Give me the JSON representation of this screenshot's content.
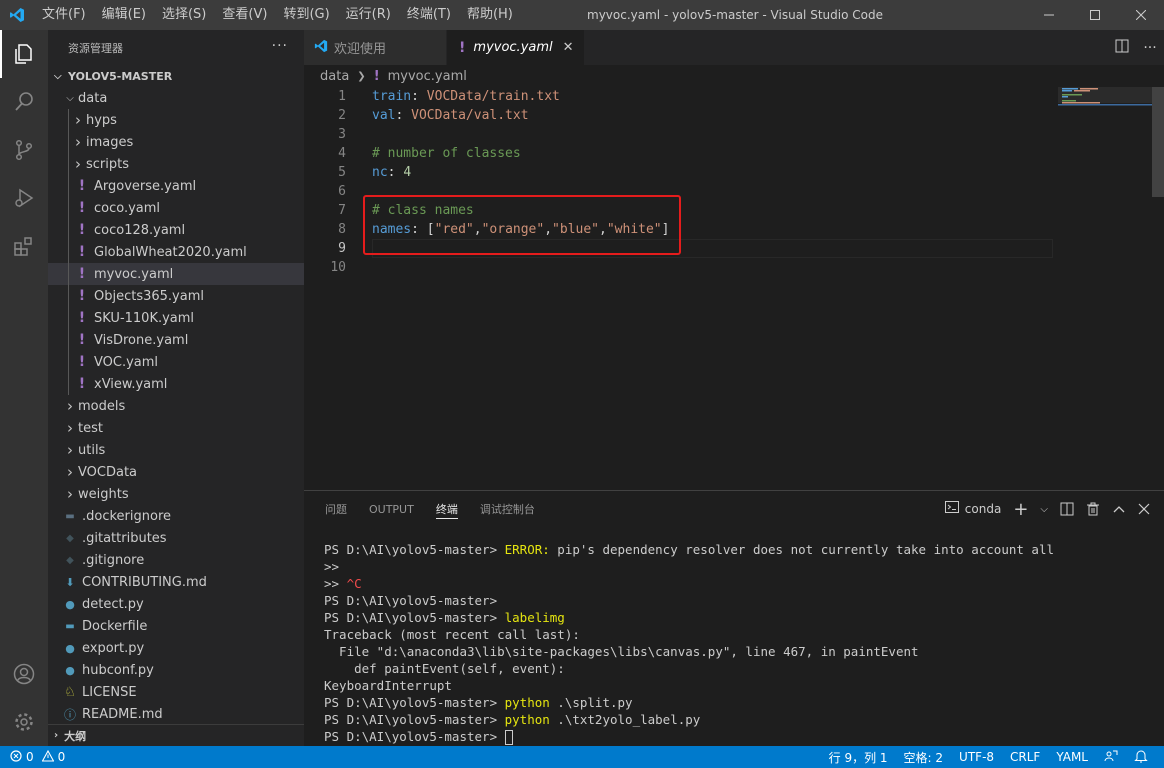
{
  "titlebar": {
    "menu": [
      "文件(F)",
      "编辑(E)",
      "选择(S)",
      "查看(V)",
      "转到(G)",
      "运行(R)",
      "终端(T)",
      "帮助(H)"
    ],
    "title": "myvoc.yaml - yolov5-master - Visual Studio Code"
  },
  "sidebar": {
    "header": "资源管理器",
    "more": "···",
    "root": "YOLOV5-MASTER",
    "tree": [
      {
        "label": "data",
        "depth": 1,
        "kind": "folder-open"
      },
      {
        "label": "hyps",
        "depth": 2,
        "kind": "folder"
      },
      {
        "label": "images",
        "depth": 2,
        "kind": "folder"
      },
      {
        "label": "scripts",
        "depth": 2,
        "kind": "folder"
      },
      {
        "label": "Argoverse.yaml",
        "depth": 2,
        "kind": "yaml"
      },
      {
        "label": "coco.yaml",
        "depth": 2,
        "kind": "yaml"
      },
      {
        "label": "coco128.yaml",
        "depth": 2,
        "kind": "yaml"
      },
      {
        "label": "GlobalWheat2020.yaml",
        "depth": 2,
        "kind": "yaml"
      },
      {
        "label": "myvoc.yaml",
        "depth": 2,
        "kind": "yaml",
        "selected": true
      },
      {
        "label": "Objects365.yaml",
        "depth": 2,
        "kind": "yaml"
      },
      {
        "label": "SKU-110K.yaml",
        "depth": 2,
        "kind": "yaml"
      },
      {
        "label": "VisDrone.yaml",
        "depth": 2,
        "kind": "yaml"
      },
      {
        "label": "VOC.yaml",
        "depth": 2,
        "kind": "yaml"
      },
      {
        "label": "xView.yaml",
        "depth": 2,
        "kind": "yaml"
      },
      {
        "label": "models",
        "depth": 1,
        "kind": "folder"
      },
      {
        "label": "test",
        "depth": 1,
        "kind": "folder"
      },
      {
        "label": "utils",
        "depth": 1,
        "kind": "folder"
      },
      {
        "label": "VOCData",
        "depth": 1,
        "kind": "folder"
      },
      {
        "label": "weights",
        "depth": 1,
        "kind": "folder"
      },
      {
        "label": ".dockerignore",
        "depth": 1,
        "kind": "docker-dim"
      },
      {
        "label": ".gitattributes",
        "depth": 1,
        "kind": "git"
      },
      {
        "label": ".gitignore",
        "depth": 1,
        "kind": "git"
      },
      {
        "label": "CONTRIBUTING.md",
        "depth": 1,
        "kind": "md-arrow"
      },
      {
        "label": "detect.py",
        "depth": 1,
        "kind": "python"
      },
      {
        "label": "Dockerfile",
        "depth": 1,
        "kind": "docker"
      },
      {
        "label": "export.py",
        "depth": 1,
        "kind": "python"
      },
      {
        "label": "hubconf.py",
        "depth": 1,
        "kind": "python"
      },
      {
        "label": "LICENSE",
        "depth": 1,
        "kind": "license"
      },
      {
        "label": "README.md",
        "depth": 1,
        "kind": "info"
      }
    ],
    "outline": "大纲"
  },
  "tabs": [
    {
      "label": "欢迎使用",
      "active": false
    },
    {
      "label": "myvoc.yaml",
      "active": true
    }
  ],
  "breadcrumb": [
    "data",
    "myvoc.yaml"
  ],
  "code": [
    {
      "num": "1",
      "tokens": [
        [
          "k",
          "train"
        ],
        [
          "p",
          ": "
        ],
        [
          "v",
          "VOCData/train.txt"
        ]
      ]
    },
    {
      "num": "2",
      "tokens": [
        [
          "k",
          "val"
        ],
        [
          "p",
          ": "
        ],
        [
          "v",
          "VOCData/val.txt"
        ]
      ]
    },
    {
      "num": "3",
      "tokens": []
    },
    {
      "num": "4",
      "tokens": [
        [
          "c",
          "# number of classes"
        ]
      ]
    },
    {
      "num": "5",
      "tokens": [
        [
          "k",
          "nc"
        ],
        [
          "p",
          ": "
        ],
        [
          "n",
          "4"
        ]
      ]
    },
    {
      "num": "6",
      "tokens": []
    },
    {
      "num": "7",
      "tokens": [
        [
          "c",
          "# class names"
        ]
      ]
    },
    {
      "num": "8",
      "tokens": [
        [
          "k",
          "names"
        ],
        [
          "p",
          ": ["
        ],
        [
          "v",
          "\"red\""
        ],
        [
          "p",
          ","
        ],
        [
          "v",
          "\"orange\""
        ],
        [
          "p",
          ","
        ],
        [
          "v",
          "\"blue\""
        ],
        [
          "p",
          ","
        ],
        [
          "v",
          "\"white\""
        ],
        [
          "p",
          "]"
        ]
      ]
    },
    {
      "num": "9",
      "tokens": [],
      "current": true
    },
    {
      "num": "10",
      "tokens": []
    }
  ],
  "panel": {
    "tabs": [
      "问题",
      "OUTPUT",
      "终端",
      "调试控制台"
    ],
    "active_tab": "终端",
    "shell": "conda",
    "terminal": [
      [
        [
          "w",
          "PS D:\\AI\\yolov5-master> "
        ],
        [
          "y",
          "ERROR:"
        ],
        [
          "w",
          " pip's dependency resolver does not currently take into account all"
        ]
      ],
      [
        [
          "w",
          ">>"
        ]
      ],
      [
        [
          "w",
          ">> "
        ],
        [
          "r",
          "^C"
        ]
      ],
      [
        [
          "w",
          "PS D:\\AI\\yolov5-master>"
        ]
      ],
      [
        [
          "w",
          "PS D:\\AI\\yolov5-master> "
        ],
        [
          "y",
          "labelimg"
        ]
      ],
      [
        [
          "w",
          "Traceback (most recent call last):"
        ]
      ],
      [
        [
          "w",
          "  File \"d:\\anaconda3\\lib\\site-packages\\libs\\canvas.py\", line 467, in paintEvent"
        ]
      ],
      [
        [
          "w",
          "    def paintEvent(self, event):"
        ]
      ],
      [
        [
          "w",
          "KeyboardInterrupt"
        ]
      ],
      [
        [
          "w",
          "PS D:\\AI\\yolov5-master> "
        ],
        [
          "y",
          "python"
        ],
        [
          "w",
          " .\\split.py"
        ]
      ],
      [
        [
          "w",
          "PS D:\\AI\\yolov5-master> "
        ],
        [
          "y",
          "python"
        ],
        [
          "w",
          " .\\txt2yolo_label.py"
        ]
      ],
      [
        [
          "w",
          "PS D:\\AI\\yolov5-master> "
        ],
        [
          "cursor",
          ""
        ]
      ]
    ]
  },
  "statusbar": {
    "errors": "0",
    "warnings": "0",
    "position": "行 9，列 1",
    "indent": "空格: 2",
    "encoding": "UTF-8",
    "eol": "CRLF",
    "language": "YAML"
  },
  "colors": {
    "accent": "#007acc",
    "highlight_box": "#e51c1c",
    "yaml_icon": "#a074c4"
  }
}
